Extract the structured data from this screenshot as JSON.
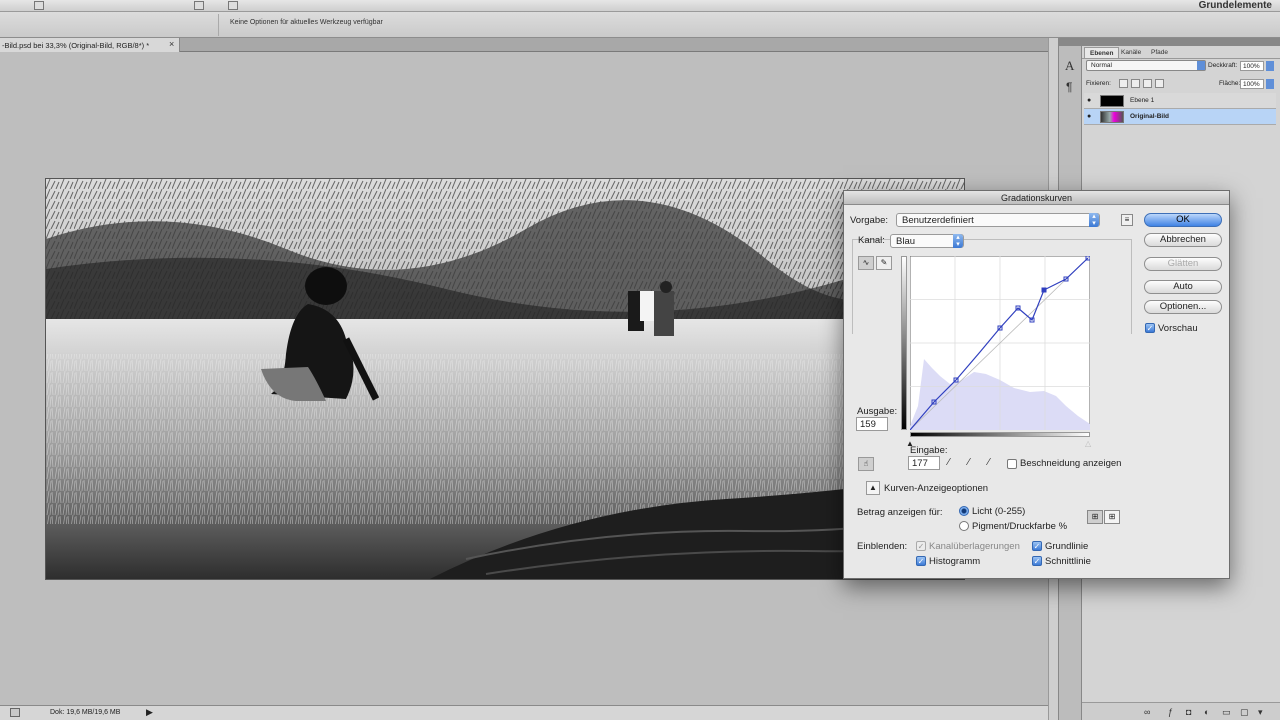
{
  "app": {
    "workspace": "Grundelemente",
    "options_message": "Keine Optionen für aktuelles Werkzeug verfügbar",
    "document_tab": "-Bild.psd bei 33,3% (Original-Bild, RGB/8*) *",
    "tab_close": "×",
    "status_doc_info": "Dok: 19,6 MB/19,6 MB"
  },
  "layers_panel": {
    "tabs": [
      "Ebenen",
      "Kanäle",
      "Pfade"
    ],
    "blend_mode": "Normal",
    "opacity_label": "Deckkraft:",
    "opacity_value": "100%",
    "lock_label": "Fixieren:",
    "fill_label": "Fläche:",
    "fill_value": "100%",
    "layers": [
      {
        "name": "Ebene 1"
      },
      {
        "name": "Original-Bild"
      }
    ]
  },
  "curves_dialog": {
    "title": "Gradationskurven",
    "preset_label": "Vorgabe:",
    "preset_value": "Benutzerdefiniert",
    "channel_label": "Kanal:",
    "channel_value": "Blau",
    "output_label": "Ausgabe:",
    "output_value": "159",
    "input_label": "Eingabe:",
    "input_value": "177",
    "clipping_label": "Beschneidung anzeigen",
    "display_options_label": "Kurven-Anzeigeoptionen",
    "show_amount_label": "Betrag anzeigen für:",
    "radio_light": "Licht (0-255)",
    "radio_pigment": "Pigment/Druckfarbe %",
    "show_label": "Einblenden:",
    "chk_channel_overlays": "Kanalüberlagerungen",
    "chk_baseline": "Grundlinie",
    "chk_histogram": "Histogramm",
    "chk_intersection": "Schnittlinie",
    "buttons": {
      "ok": "OK",
      "cancel": "Abbrechen",
      "smooth": "Glätten",
      "auto": "Auto",
      "options": "Optionen..."
    },
    "preview_label": "Vorschau",
    "preview_checked": true,
    "light_selected": true
  },
  "colors": {
    "accent": "#3f82e4",
    "selected_layer": "#b8d4f6",
    "histogram_fill": "#dcdcf6",
    "curve": "#2f3fbf"
  }
}
